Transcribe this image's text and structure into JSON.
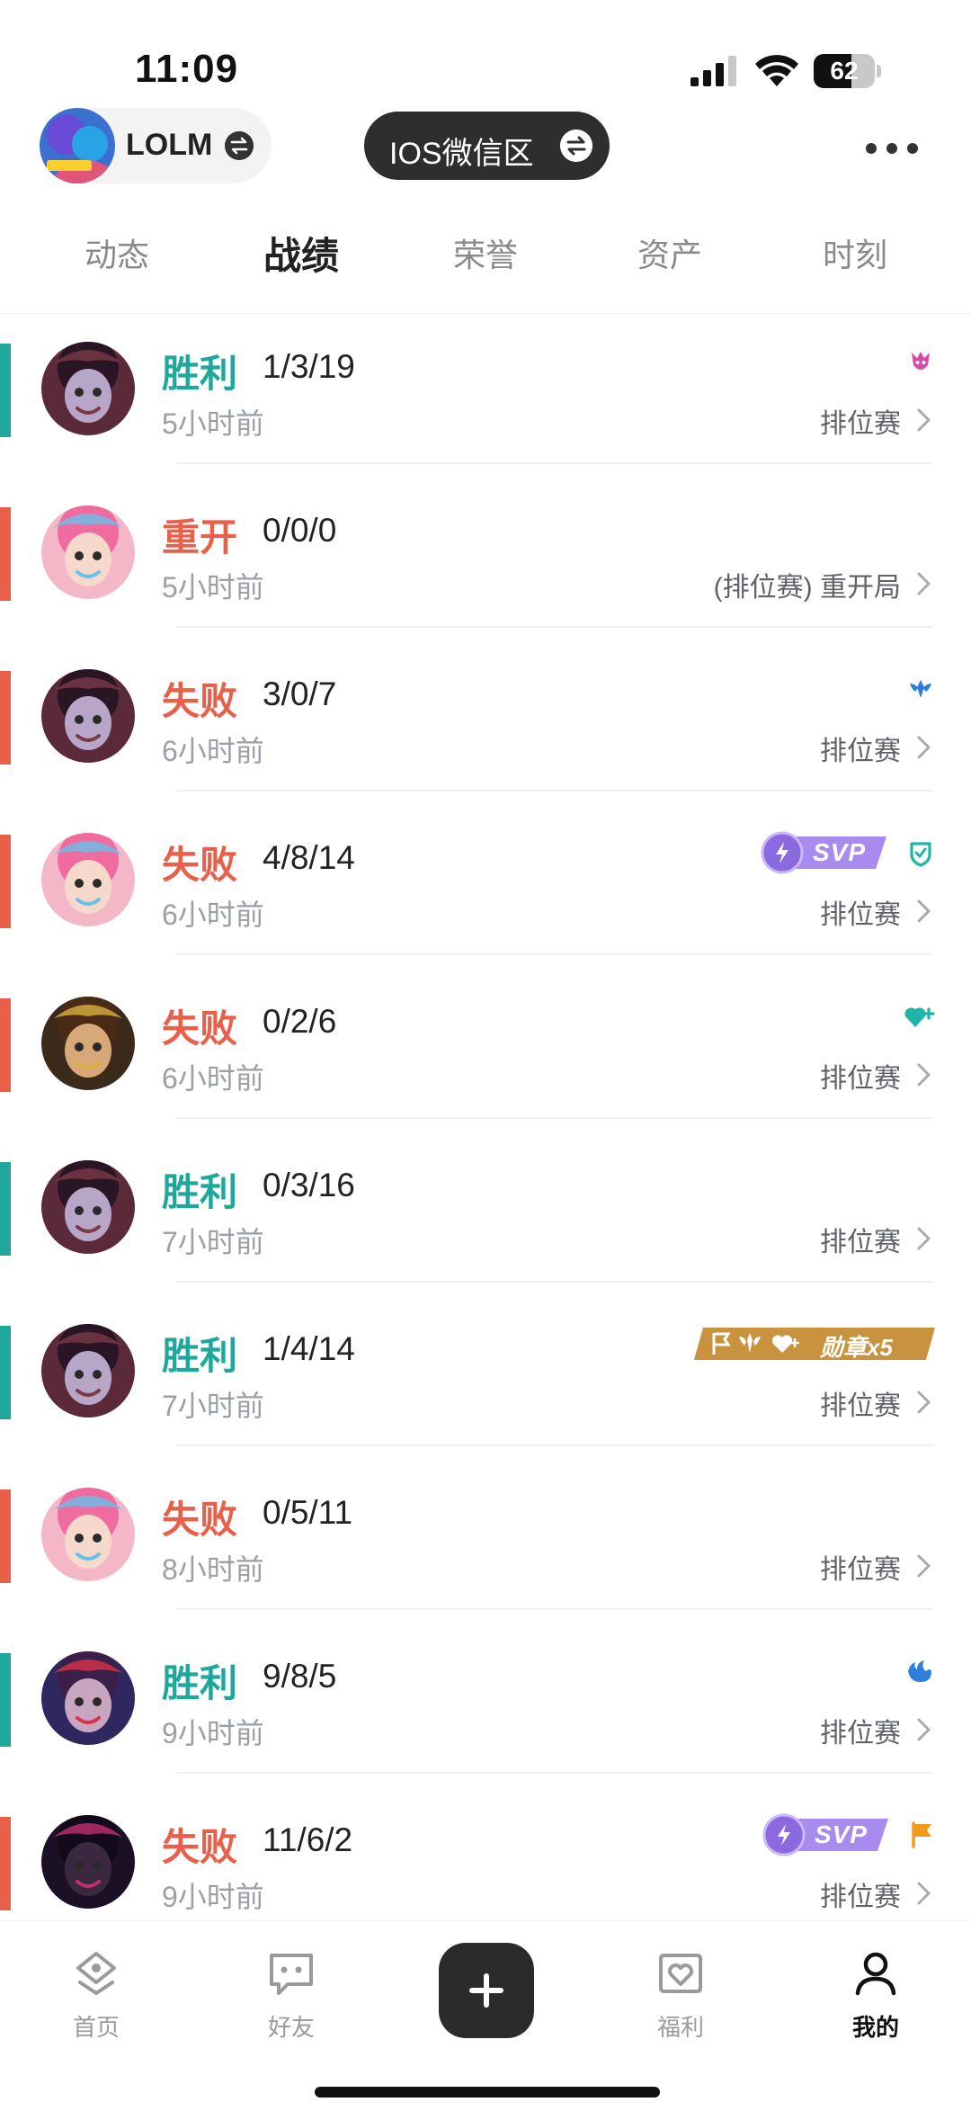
{
  "status": {
    "time": "11:09",
    "battery": "62",
    "battery_fraction": 0.62
  },
  "header": {
    "game_name": "LOLM",
    "server_name": "IOS微信区"
  },
  "tabs": [
    {
      "label": "动态"
    },
    {
      "label": "战绩"
    },
    {
      "label": "荣誉"
    },
    {
      "label": "资产"
    },
    {
      "label": "时刻"
    }
  ],
  "active_tab": "战绩",
  "colors": {
    "win": "#1fa79c",
    "loss": "#e8604a",
    "remake": "#e8604a"
  },
  "matches": [
    {
      "result": "胜利",
      "kda": "1/3/19",
      "time_ago": "5小时前",
      "mode": "排位赛",
      "outcome": "win",
      "badges": [
        "mvp-demon-icon"
      ]
    },
    {
      "result": "重开",
      "kda": "0/0/0",
      "time_ago": "5小时前",
      "mode": "(排位赛) 重开局",
      "outcome": "remake",
      "badges": []
    },
    {
      "result": "失败",
      "kda": "3/0/7",
      "time_ago": "6小时前",
      "mode": "排位赛",
      "outcome": "loss",
      "badges": [
        "support-icon"
      ]
    },
    {
      "result": "失败",
      "kda": "4/8/14",
      "time_ago": "6小时前",
      "mode": "排位赛",
      "outcome": "loss",
      "badges": [
        "svp-badge",
        "shield-icon"
      ],
      "svp_label": "SVP"
    },
    {
      "result": "失败",
      "kda": "0/2/6",
      "time_ago": "6小时前",
      "mode": "排位赛",
      "outcome": "loss",
      "badges": [
        "heal-heart-icon"
      ]
    },
    {
      "result": "胜利",
      "kda": "0/3/16",
      "time_ago": "7小时前",
      "mode": "排位赛",
      "outcome": "win",
      "badges": []
    },
    {
      "result": "胜利",
      "kda": "1/4/14",
      "time_ago": "7小时前",
      "mode": "排位赛",
      "outcome": "win",
      "badges": [
        "medal-strip"
      ],
      "medal_label": "勋章x5"
    },
    {
      "result": "失败",
      "kda": "0/5/11",
      "time_ago": "8小时前",
      "mode": "排位赛",
      "outcome": "loss",
      "badges": []
    },
    {
      "result": "胜利",
      "kda": "9/8/5",
      "time_ago": "9小时前",
      "mode": "排位赛",
      "outcome": "win",
      "badges": [
        "fire-hand-icon"
      ]
    },
    {
      "result": "失败",
      "kda": "11/6/2",
      "time_ago": "9小时前",
      "mode": "排位赛",
      "outcome": "loss",
      "badges": [
        "svp-badge",
        "flag-icon"
      ],
      "svp_label": "SVP"
    }
  ],
  "bottom_nav": [
    {
      "label": "首页",
      "icon": "home-icon"
    },
    {
      "label": "好友",
      "icon": "chat-icon"
    },
    {
      "label": "",
      "icon": "plus-icon"
    },
    {
      "label": "福利",
      "icon": "gift-heart-icon"
    },
    {
      "label": "我的",
      "icon": "profile-icon"
    }
  ]
}
